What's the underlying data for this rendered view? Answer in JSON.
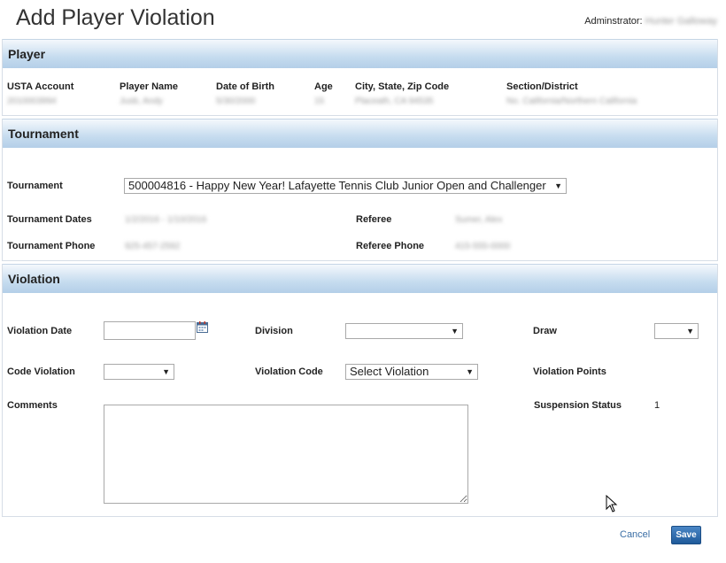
{
  "header": {
    "title": "Add Player Violation",
    "admin_label": "Adminstrator:",
    "admin_name": "Hunter Galloway"
  },
  "player": {
    "section_title": "Player",
    "columns": [
      {
        "label": "USTA Account",
        "value": "2010003994"
      },
      {
        "label": "Player Name",
        "value": "Jusb, Andy"
      },
      {
        "label": "Date of Birth",
        "value": "5/30/2000"
      },
      {
        "label": "Age",
        "value": "15"
      },
      {
        "label": "City, State, Zip Code",
        "value": "Placeath, CA 94535"
      },
      {
        "label": "Section/District",
        "value": "No. California/Northern California"
      }
    ]
  },
  "tournament": {
    "section_title": "Tournament",
    "tournament_label": "Tournament",
    "tournament_selected": "500004816 - Happy New Year! Lafayette Tennis Club Junior Open and Challenger",
    "dates_label": "Tournament Dates",
    "dates_value": "1/2/2016 - 1/10/2016",
    "referee_label": "Referee",
    "referee_value": "Sumer, Alex",
    "phone_label": "Tournament Phone",
    "phone_value": "925-457-2592",
    "referee_phone_label": "Referee Phone",
    "referee_phone_value": "415-555-0000"
  },
  "violation": {
    "section_title": "Violation",
    "date_label": "Violation Date",
    "date_value": "",
    "division_label": "Division",
    "division_value": "",
    "draw_label": "Draw",
    "draw_value": "",
    "code_violation_label": "Code Violation",
    "code_violation_value": "",
    "violation_code_label": "Violation Code",
    "violation_code_value": "Select Violation",
    "violation_points_label": "Violation Points",
    "comments_label": "Comments",
    "comments_value": "",
    "suspension_label": "Suspension Status",
    "suspension_value": "1"
  },
  "footer": {
    "cancel_label": "Cancel",
    "save_label": "Save"
  }
}
